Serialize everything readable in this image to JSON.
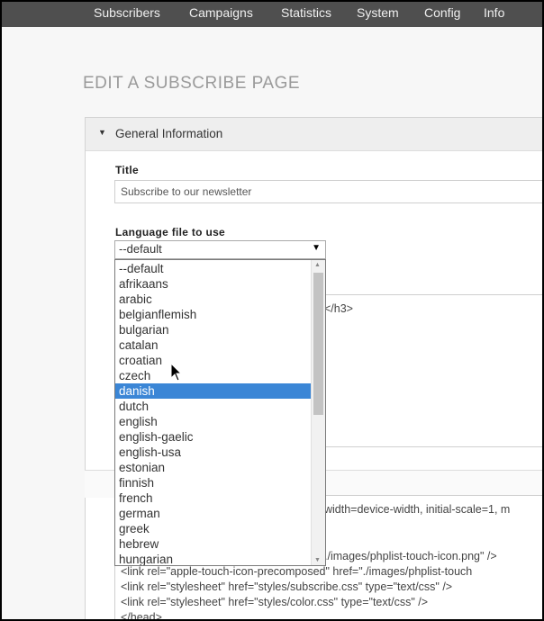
{
  "nav": {
    "items": [
      "Subscribers",
      "Campaigns",
      "Statistics",
      "System",
      "Config",
      "Info"
    ]
  },
  "page": {
    "title": "EDIT A SUBSCRIBE PAGE"
  },
  "panel": {
    "header": "General Information"
  },
  "form": {
    "title_label": "Title",
    "title_value": "Subscribe to our newsletter",
    "language_label": "Language file to use",
    "language_selected": "--default"
  },
  "dropdown": {
    "options": [
      "--default",
      "afrikaans",
      "arabic",
      "belgianflemish",
      "bulgarian",
      "catalan",
      "croatian",
      "czech",
      "danish",
      "dutch",
      "english",
      "english-gaelic",
      "english-usa",
      "estonian",
      "finnish",
      "french",
      "german",
      "greek",
      "hebrew",
      "hungarian"
    ],
    "highlighted": "danish"
  },
  "header_area": {
    "fragment": "</h3>"
  },
  "head_area": {
    "fragment_top": "width=device-width, initial-scale=1, m",
    "lines": [
      "./images/phplist-touch-icon.png\" />",
      "<link rel=\"apple-touch-icon-precomposed\" href=\"./images/phplist-touch",
      "<link rel=\"stylesheet\" href=\"styles/subscribe.css\" type=\"text/css\" />",
      "<link rel=\"stylesheet\" href=\"styles/color.css\" type=\"text/css\" />",
      "</head>"
    ]
  },
  "colors": {
    "nav_bg": "#4f4f4f",
    "selection": "#3b86d6"
  }
}
